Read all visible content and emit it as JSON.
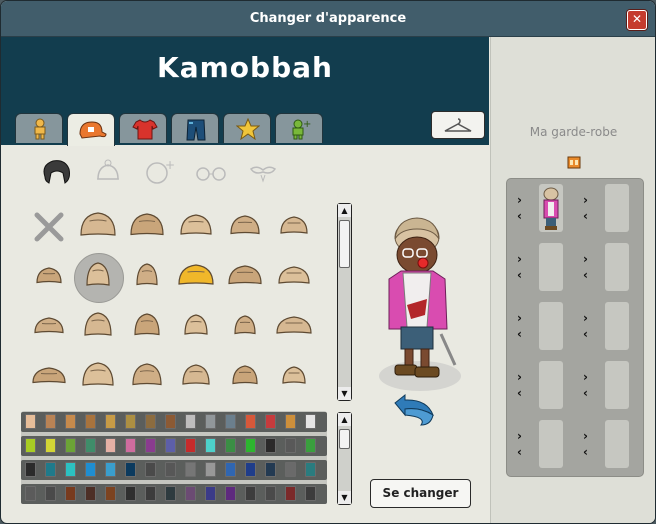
{
  "window": {
    "title": "Changer d'apparence",
    "close_glyph": "✕"
  },
  "user": {
    "name": "Kamobbah"
  },
  "tabs": [
    {
      "name": "body",
      "icon": "body-icon",
      "active": false
    },
    {
      "name": "head",
      "icon": "cap-icon",
      "active": true
    },
    {
      "name": "torso",
      "icon": "shirt-icon",
      "active": false
    },
    {
      "name": "legs",
      "icon": "pants-icon",
      "active": false
    },
    {
      "name": "favorites",
      "icon": "star-icon",
      "active": false
    },
    {
      "name": "effects",
      "icon": "effects-icon",
      "active": false
    }
  ],
  "wardrobe_button": {
    "icon": "hanger-icon"
  },
  "categories": [
    "hair",
    "hats",
    "accessories",
    "glasses",
    "moustaches"
  ],
  "hair_grid": {
    "rows": 4,
    "cols": 6,
    "selected_index": 7,
    "first_item": "none"
  },
  "palette": {
    "rows": [
      [
        "#e6bd99",
        "#b98355",
        "#c68a4c",
        "#a8733d",
        "#c79b46",
        "#ac8f42",
        "#8c6c3f",
        "#8c5a34",
        "#bebdbd",
        "#91979a",
        "#6b7f8d",
        "#d6583a",
        "#c63b3d",
        "#cd8f3b",
        "#e4e4e4"
      ],
      [
        "#a8cc23",
        "#d2d535",
        "#6ca336",
        "#3f8d6a",
        "#e5b0a5",
        "#cf6c9e",
        "#8a3c8f",
        "#5d5fa8",
        "#c62b2b",
        "#4dd0c9",
        "#3b8e45",
        "#2db52f",
        "#2b2a2a",
        "#595959",
        "#3a9f3e"
      ],
      [
        "#2b2b2b",
        "#1f7a8b",
        "#2cc1c1",
        "#1f8ed1",
        "#3a9ecd",
        "#0b3a5e",
        "#4a4a4a",
        "#575757",
        "#767676",
        "#989898",
        "#3066b1",
        "#1f3d8a",
        "#233a52",
        "#6a6a6a",
        "#2a7c7f"
      ],
      [
        "#5b5b5b",
        "#4a4a4a",
        "#783b1e",
        "#4d2f26",
        "#7c4321",
        "#2f2f2f",
        "#3c3c3c",
        "#2e3b3f",
        "#6b4b73",
        "#3b3b88",
        "#5e2a7e",
        "#3d3d3d",
        "#4a4a4a",
        "#7b2a2a",
        "#3c3c3c"
      ]
    ]
  },
  "wardrobe": {
    "title": "Ma garde-robe",
    "slots": 10
  },
  "change_button": {
    "label": "Se changer"
  }
}
